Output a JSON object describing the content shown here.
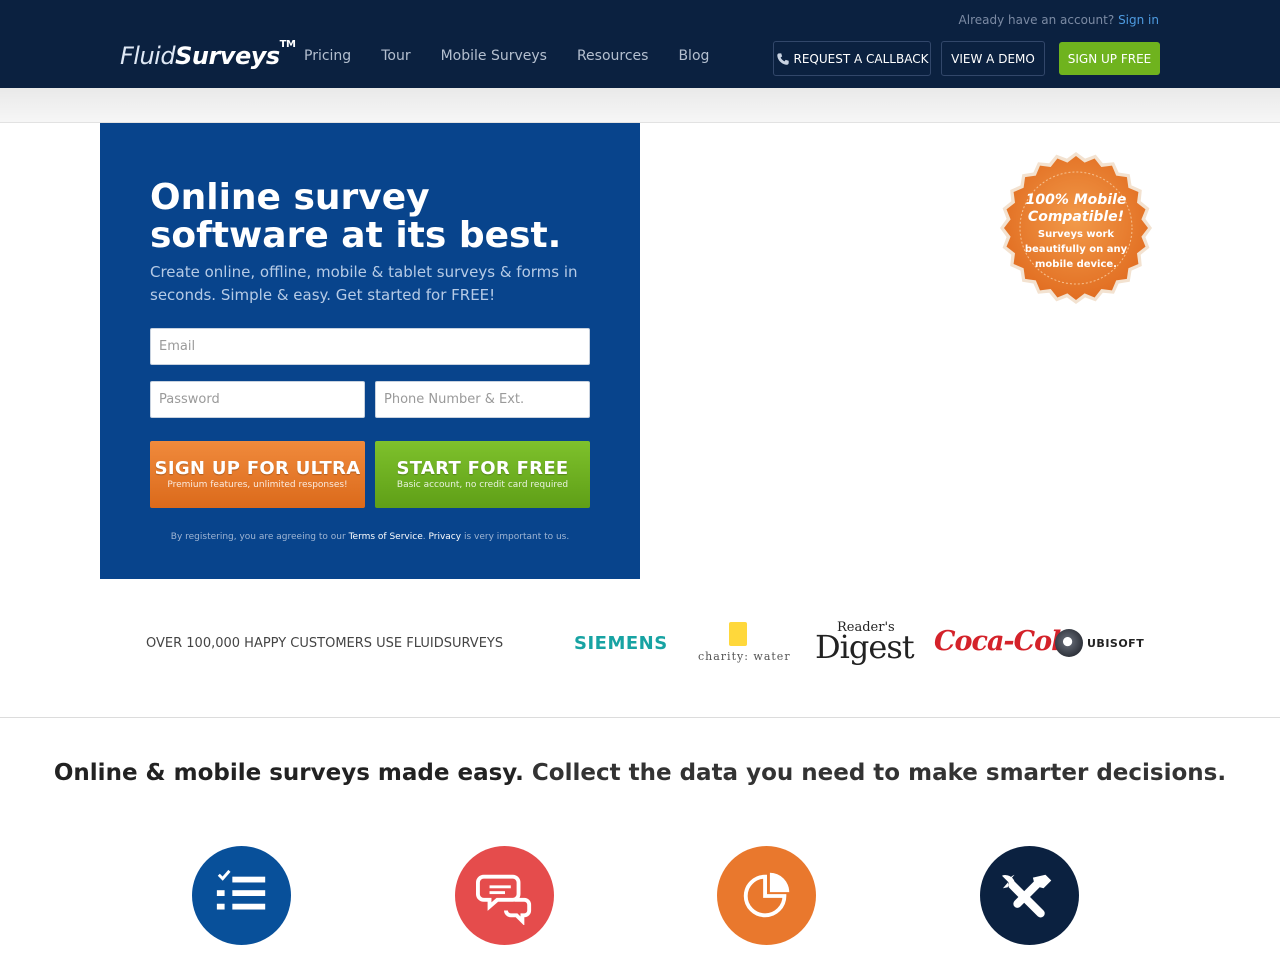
{
  "header": {
    "logo_main": "Fluid",
    "logo_bold": "Surveys",
    "logo_tm": "TM",
    "account_prompt": "Already have an account?",
    "signin_label": "Sign in",
    "nav": [
      "Pricing",
      "Tour",
      "Mobile Surveys",
      "Resources",
      "Blog"
    ],
    "callback_label": "REQUEST A CALLBACK",
    "demo_label": "VIEW A DEMO",
    "signup_label": "SIGN UP FREE"
  },
  "hero": {
    "title_line1": "Online survey",
    "title_line2": "software at its best.",
    "subtitle": "Create online, offline, mobile & tablet surveys & forms in seconds. Simple & easy. Get started for FREE!",
    "email_placeholder": "Email",
    "password_placeholder": "Password",
    "phone_placeholder": "Phone Number & Ext.",
    "ultra_label": "SIGN UP FOR ULTRA",
    "ultra_sub": "Premium features, unlimited responses!",
    "free_label": "START FOR FREE",
    "free_sub": "Basic account, no credit card required",
    "terms_pre": "By registering, you are agreeing to our",
    "terms_link": "Terms of Service",
    "terms_mid": ".",
    "privacy_link": "Privacy",
    "terms_post": "is very important to us."
  },
  "badge": {
    "line1": "100% Mobile",
    "line2": "Compatible!",
    "line3": "Surveys work",
    "line4": "beautifully on any",
    "line5": "mobile device.",
    "color": "#e9782d"
  },
  "customers": {
    "label": "OVER 100,000 HAPPY CUSTOMERS USE FLUIDSURVEYS",
    "siemens": "SIEMENS",
    "charity": "charity: water",
    "reader_top": "Reader's",
    "reader_bottom": "Digest",
    "coke": "Coca-Cola",
    "ubisoft": "UBISOFT"
  },
  "tagline": {
    "bold": "Online & mobile surveys made easy.",
    "rest": "Collect the data you need to make smarter decisions."
  },
  "features": [
    {
      "icon": "checklist-icon",
      "color": "#08509a"
    },
    {
      "icon": "chat-bubbles-icon",
      "color": "#e54c4c"
    },
    {
      "icon": "pie-chart-icon",
      "color": "#e9782d"
    },
    {
      "icon": "tools-icon",
      "color": "#0b2140"
    }
  ]
}
